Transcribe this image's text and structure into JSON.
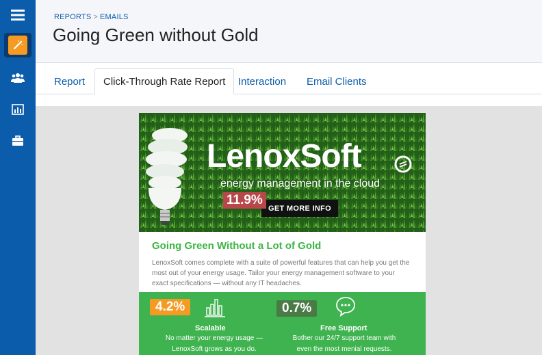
{
  "sidebar": {
    "icons": [
      "menu-icon",
      "magic-wand-icon",
      "people-icon",
      "bar-chart-icon",
      "briefcase-icon"
    ]
  },
  "header": {
    "breadcrumb": [
      "REPORTS",
      ">",
      "EMAILS"
    ],
    "title": "Going Green without Gold"
  },
  "tabs": [
    {
      "label": "Report"
    },
    {
      "label": "Click-Through Rate Report",
      "active": true
    },
    {
      "label": "Interaction"
    },
    {
      "label": "Email Clients"
    }
  ],
  "email": {
    "brand": "LenoxSoft",
    "tagline": "energy management in the cloud",
    "cta_rate": "11.9%",
    "cta_label": "GET MORE INFO",
    "heading": "Going Green Without a Lot of Gold",
    "body": "LenoxSoft comes complete with a suite of powerful features that can help you get the most out of your energy usage. Tailor your energy management software to your exact specifications — without any IT headaches.",
    "features": [
      {
        "rate": "4.2%",
        "title": "Scalable",
        "text_line1": "No matter your energy usage —",
        "text_line2": "LenoxSoft grows as you do."
      },
      {
        "rate": "0.7%",
        "title": "Free Support",
        "text_line1": "Bother our 24/7 support team with",
        "text_line2": "even the most menial requests."
      }
    ]
  },
  "colors": {
    "sidebar": "#0b5cab",
    "accent_orange": "#f59a23",
    "green": "#3fb34f",
    "heading_green": "#3db545",
    "rate_red": "#b8474a",
    "rate_orange": "#f59a23",
    "rate_darkgreen": "#4a7a45"
  }
}
